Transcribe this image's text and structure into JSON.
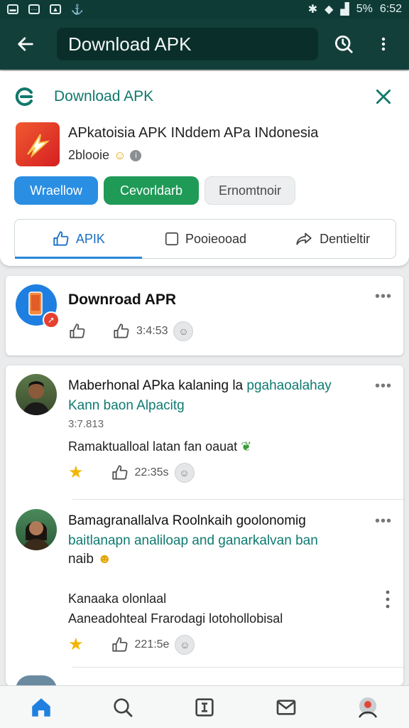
{
  "status_bar": {
    "battery": "5%",
    "time": "6:52"
  },
  "app_bar": {
    "search_text": "Download APK"
  },
  "top_card": {
    "title": "Download APK",
    "app_title": "APkatoisia APK INddem APa INdonesia",
    "app_subtitle": "2blooie",
    "chips": [
      "Wraellow",
      "Cevorldarb",
      "Ernomtnoir"
    ],
    "tabs": [
      "APIK",
      "Pooieooad",
      "Dentieltir"
    ]
  },
  "posts": [
    {
      "name": "Downroad APR",
      "likes": "3:4:53"
    },
    {
      "name": "Maberhonal APka kalaning la",
      "name_tail": "pgahaoalahay",
      "subline": "Kann baon Alpacitg",
      "time": "3:7.813",
      "body": "Ramaktualloal latan fan oauat",
      "likes": "22:35s"
    },
    {
      "name": "Bamagranallalva Roolnkaih goolonomig",
      "subline": "baitlanapn analiloap and ganarkalvan ban",
      "subline2": "naib",
      "body1": "Kanaaka olonlaal",
      "body2": "Aaneadohteal Frarodagi lotohollobisal",
      "likes": "221:5e"
    }
  ],
  "colors": {
    "header": "#123f3a",
    "accent": "#12786b",
    "blue_chip": "#2a8ee3",
    "green_chip": "#1f9a57"
  }
}
